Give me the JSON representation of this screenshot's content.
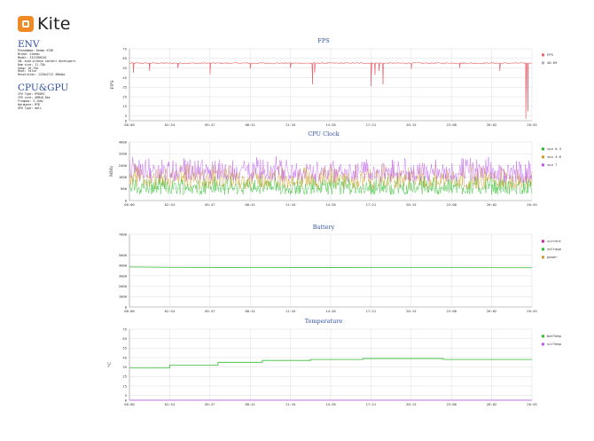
{
  "app": {
    "logo_text": "Kite"
  },
  "env": {
    "title": "ENV",
    "lines": [
      "PhoneName: Redmi K70E",
      "Brand: Xiaomi",
      "Model: 23113RKC6C",
      "SN: auto:please contact developers",
      "Ram size: 11.7Gb",
      "Swap: 16.7Gb",
      "Root: false",
      "Resolution: 1220x2712 480dpi"
    ]
  },
  "cpugpu": {
    "title": "CPU&GPU",
    "lines": [
      "CPU Type: MT6897",
      "CPU core: ARMv8_64a",
      "Freqmax: 3.1GHz",
      "Hardware: MTK",
      "GPU Type: mali"
    ]
  },
  "time_ticks": [
    "00:00",
    "02:54",
    "05:47",
    "08:41",
    "11:34",
    "14:28",
    "17:21",
    "20:15",
    "23:08",
    "26:02",
    "28:55"
  ],
  "colors": {
    "fps": "#e8636c",
    "fps_dashed": "#aab0c8",
    "cpu_0_3": "#22bb22",
    "cpu_4_6": "#cc9922",
    "cpu_7": "#bb55ee",
    "battery_current": "#cc22aa",
    "battery_voltage": "#33bb33",
    "battery_power": "#cc9922",
    "temp_bat": "#33bb33",
    "temp_vir": "#bb55ee",
    "grid": "#dddddd",
    "axis_text": "#333333",
    "title_text": "#2d4fa1"
  },
  "chart_data": [
    {
      "type": "line",
      "title": "FPS",
      "ylabel": "FPS",
      "ylim": [
        0,
        75
      ],
      "yticks": [
        "0",
        "5",
        "15",
        "25",
        "35",
        "45",
        "55",
        "65",
        "75"
      ],
      "ytick_values": [
        0,
        5,
        15,
        25,
        35,
        45,
        55,
        65,
        75
      ],
      "legend_position": "right",
      "series": [
        {
          "name": "FPS",
          "color": "#e8636c",
          "baseline": 60,
          "dips": [
            [
              0.01,
              50
            ],
            [
              0.05,
              52
            ],
            [
              0.12,
              55
            ],
            [
              0.2,
              48
            ],
            [
              0.3,
              54
            ],
            [
              0.4,
              55
            ],
            [
              0.455,
              38
            ],
            [
              0.46,
              50
            ],
            [
              0.6,
              36
            ],
            [
              0.61,
              48
            ],
            [
              0.62,
              52
            ],
            [
              0.63,
              38
            ],
            [
              0.7,
              54
            ],
            [
              0.82,
              55
            ],
            [
              0.92,
              52
            ],
            [
              0.985,
              2
            ],
            [
              0.99,
              10
            ]
          ]
        },
        {
          "name": "40.69",
          "color": "#aab0c8",
          "value": 40.69,
          "dashed": true
        }
      ]
    },
    {
      "type": "line",
      "title": "CPU Clock",
      "ylabel": "MHz",
      "ylim": [
        0,
        4000
      ],
      "yticks": [
        "0",
        "800",
        "1600",
        "2400",
        "3200",
        "4000"
      ],
      "ytick_values": [
        0,
        800,
        1600,
        2400,
        3200,
        4000
      ],
      "legend_position": "right",
      "series": [
        {
          "name": "cpu 0-3",
          "color": "#22bb22",
          "range": [
            400,
            1800
          ],
          "center": 1000
        },
        {
          "name": "cpu 4-6",
          "color": "#cc9922",
          "range": [
            800,
            2600
          ],
          "center": 1500
        },
        {
          "name": "cpu 7",
          "color": "#bb55ee",
          "range": [
            1200,
            3000
          ],
          "center": 2000
        }
      ]
    },
    {
      "type": "line",
      "title": "Battery",
      "ylim": [
        0,
        7000
      ],
      "yticks": [
        "0",
        "1000",
        "2000",
        "3000",
        "4000",
        "5000",
        "7000"
      ],
      "ytick_values": [
        0,
        1000,
        2000,
        3000,
        4000,
        5000,
        7000
      ],
      "legend_position": "right",
      "series": [
        {
          "name": "current",
          "color": "#cc22aa",
          "points": []
        },
        {
          "name": "voltage",
          "color": "#33bb33",
          "points": [
            [
              0,
              3850
            ],
            [
              0.1,
              3820
            ],
            [
              0.3,
              3800
            ],
            [
              0.6,
              3790
            ],
            [
              1,
              3780
            ]
          ]
        },
        {
          "name": "power",
          "color": "#cc9922",
          "points": []
        }
      ]
    },
    {
      "type": "line",
      "title": "Temperature",
      "ylabel": "°C",
      "ylim": [
        0,
        75
      ],
      "yticks": [
        "0",
        "5",
        "15",
        "25",
        "35",
        "45",
        "55",
        "65",
        "75"
      ],
      "ytick_values": [
        0,
        5,
        15,
        25,
        35,
        45,
        55,
        65,
        75
      ],
      "legend_position": "right",
      "series": [
        {
          "name": "batTemp",
          "color": "#33bb33",
          "steps": [
            [
              0,
              34
            ],
            [
              0.1,
              37
            ],
            [
              0.22,
              40
            ],
            [
              0.33,
              42
            ],
            [
              0.45,
              43
            ],
            [
              0.58,
              44
            ],
            [
              0.78,
              43
            ],
            [
              1,
              43
            ]
          ]
        },
        {
          "name": "virTemp",
          "color": "#bb55ee",
          "steps": [
            [
              0,
              0
            ],
            [
              1,
              0
            ]
          ]
        }
      ]
    }
  ]
}
